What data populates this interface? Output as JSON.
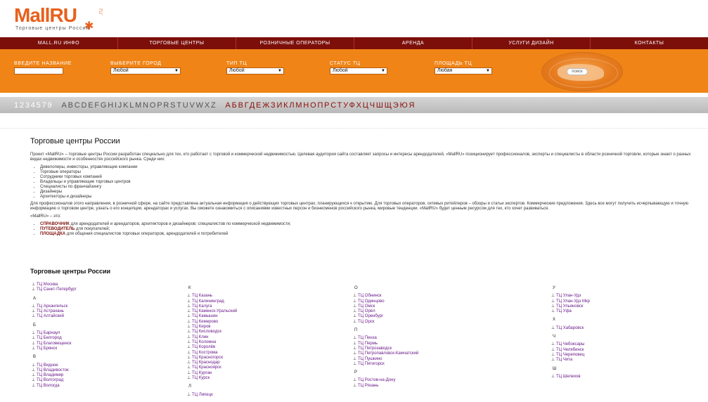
{
  "logo": {
    "main_a": "Mall",
    "main_b": "RU",
    "sup": ".ru",
    "tagline": "Торговые центры России"
  },
  "nav": [
    "Mall.ru инфо",
    "Торговые центры",
    "Розничные операторы",
    "Аренда",
    "Услуги дизайн",
    "Контакты"
  ],
  "search": {
    "name_label": "Введите название",
    "city_label": "Выберите город",
    "city_value": "Любой",
    "type_label": "Тип ТЦ",
    "type_value": "Любой",
    "status_label": "Статус ТЦ",
    "status_value": "Любой",
    "area_label": "Площадь ТЦ",
    "area_value": "Любая",
    "find_label": "поиск"
  },
  "alphabet": {
    "digits": "1234579",
    "latin": "ABCDEFGHIJKLMNOPRSTUVWXZ",
    "cyrillic": "АБВГДЕЖЗИКЛМНОПРСТУФХЦЧШЩЭЮЯ"
  },
  "main": {
    "title": "Торговые центры России",
    "intro": "Проект «MallRU» – торговые центры России разработан специально для тех, кто работает с торговой и коммерческой недвижимостью. Целевая аудитория сайта составляет запросы и интересы арендодателей, «MallRU» позиционирует профессионалов, эксперты и специалисты в области розничной торговли, которые знают о разных видах недвижимости и особенностях российского рынка. Среди них:",
    "audience": [
      "Девелоперы, инвесторы, управляющие компании",
      "Торговые операторы",
      "Сотрудники торговых компаний",
      "Владельцы и управляющие торговых центров",
      "Специалисты по франчайзингу",
      "Дизайнеры",
      "Архитекторы и дизайнеры"
    ],
    "para2": "Для профессионалов этого направления, в розничной сфере, на сайте представлена актуальная информация о действующих торговых центрах, планирующихся к открытию. Для торговых операторов, сетевых ритейлеров – обзоры и статьи экспертов. Коммерческие предложения. Здесь все могут получить исчерпывающую и точную информацию о торговом центре, узнать о его концепции, арендаторах и услугах. Вы сможете ознакомиться с описаниями известных персон и бизнесменов российского рынка, мировые тенденции. «MallRU» будет ценным ресурсом для тех, кто хочет развиваться.",
    "mallru_is": "«MallRU» – это:",
    "features": [
      {
        "hl": "СПРАВОЧНИК",
        "text": " для арендодателей и арендаторов, архитекторов и дизайнеров; специалистов по коммерческой недвижимости;"
      },
      {
        "hl": "ПУТЕВОДИТЕЛЬ",
        "text": " для покупателей;"
      },
      {
        "hl": "ПЛОЩАДКА",
        "text": " для общения специалистов торговых операторов, арендодателей и потребителей"
      }
    ],
    "cities_title": "Торговые центры России"
  },
  "cities": {
    "col1": [
      {
        "letter": "",
        "items": [
          "ТЦ Москва",
          "ТЦ Санкт-Петербург"
        ]
      },
      {
        "letter": "А",
        "items": [
          "ТЦ Архангельск",
          "ТЦ Астрахань",
          "ТЦ Алтайский"
        ]
      },
      {
        "letter": "Б",
        "items": [
          "ТЦ Барнаул",
          "ТЦ Белгород",
          "ТЦ Благовещенск",
          "ТЦ Брянск"
        ]
      },
      {
        "letter": "В",
        "items": [
          "ТЦ Видное",
          "ТЦ Владивосток",
          "ТЦ Владимир",
          "ТЦ Волгоград",
          "ТЦ Вологда"
        ]
      }
    ],
    "col2": [
      {
        "letter": "К",
        "items": [
          "ТЦ Казань",
          "ТЦ Калининград",
          "ТЦ Калуга",
          "ТЦ Каменск-Уральский",
          "ТЦ Камышин",
          "ТЦ Кемерово",
          "ТЦ Киров",
          "ТЦ Кисловодск",
          "ТЦ Клин",
          "ТЦ Коломна",
          "ТЦ Королёв",
          "ТЦ Кострома",
          "ТЦ Красногорск",
          "ТЦ Краснодар",
          "ТЦ Красноярск",
          "ТЦ Курган",
          "ТЦ Курск"
        ]
      },
      {
        "letter": "Л",
        "items": [
          "ТЦ Липецк"
        ]
      }
    ],
    "col3": [
      {
        "letter": "О",
        "items": [
          "ТЦ Обнинск",
          "ТЦ Одинцово",
          "ТЦ Омск",
          "ТЦ Орёл",
          "ТЦ Оренбург",
          "ТЦ Орск"
        ]
      },
      {
        "letter": "П",
        "items": [
          "ТЦ Пенза",
          "ТЦ Пермь",
          "ТЦ Петрозаводск",
          "ТЦ Петропавловск-Камчатский",
          "ТЦ Пушкино",
          "ТЦ Пятигорск"
        ]
      },
      {
        "letter": "Р",
        "items": [
          "ТЦ Ростов-на-Дону",
          "ТЦ Рязань"
        ]
      }
    ],
    "col4": [
      {
        "letter": "У",
        "items": [
          "ТЦ Улан-Удэ",
          "ТЦ Улан-Удэ Мкр",
          "ТЦ Ульяновск",
          "ТЦ Уфа"
        ]
      },
      {
        "letter": "Х",
        "items": [
          "ТЦ Хабаровск"
        ]
      },
      {
        "letter": "Ч",
        "items": [
          "ТЦ Чебоксары",
          "ТЦ Челябинск",
          "ТЦ Череповец",
          "ТЦ Чита"
        ]
      },
      {
        "letter": "Ш",
        "items": [
          "ТЦ Шелехов"
        ]
      }
    ]
  }
}
